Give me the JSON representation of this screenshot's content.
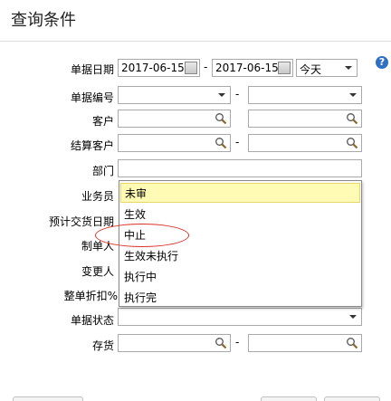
{
  "title": "查询条件",
  "fields": {
    "date": {
      "label": "单据日期",
      "from": "2017-06-15",
      "to": "2017-06-15",
      "range": "今天"
    },
    "doc_no": {
      "label": "单据编号"
    },
    "customer": {
      "label": "客户"
    },
    "settle_customer": {
      "label": "结算客户"
    },
    "department": {
      "label": "部门"
    },
    "salesperson": {
      "label": "业务员"
    },
    "est_delivery": {
      "label": "预计交货日期"
    },
    "creator": {
      "label": "制单人"
    },
    "modifier": {
      "label": "变更人"
    },
    "discount": {
      "label": "整单折扣%"
    },
    "status": {
      "label": "单据状态"
    },
    "inventory": {
      "label": "存货"
    }
  },
  "separator": "-",
  "status_options": [
    "未审",
    "生效",
    "中止",
    "生效未执行",
    "执行中",
    "执行完"
  ],
  "help_glyph": "?",
  "icons": {
    "calendar": "calendar-icon",
    "search": "search-icon",
    "dropdown": "chevron-down-icon",
    "help": "help-icon"
  },
  "colors": {
    "highlight": "#fffbb5",
    "annotation": "#d9302c",
    "help": "#2f6fc4"
  }
}
